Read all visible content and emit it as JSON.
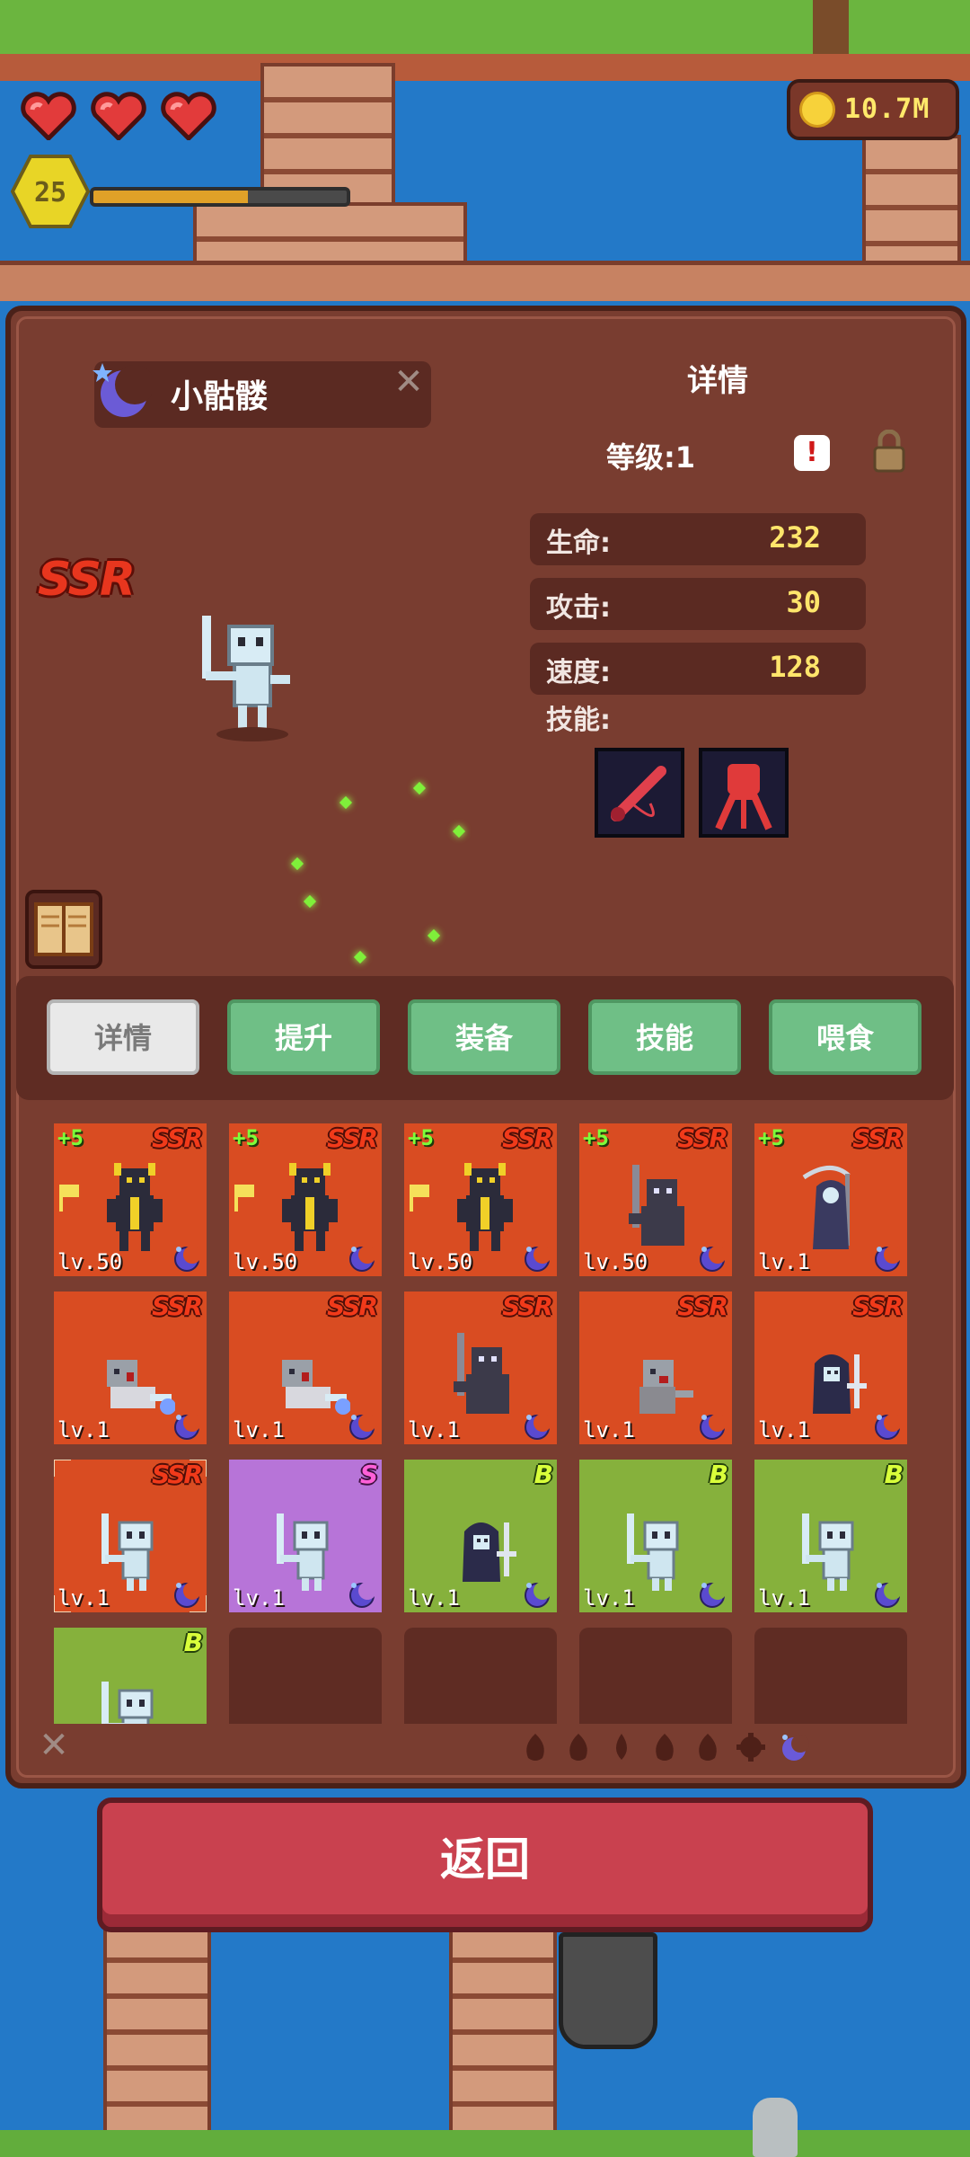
{
  "hud": {
    "hearts": 3,
    "player_level": "25",
    "xp_progress": 0.61,
    "coins": "10.7M"
  },
  "unit": {
    "name": "小骷髅",
    "rarity": "SSR",
    "detail_title": "详情",
    "level_text": "等级:1",
    "alert_glyph": "!",
    "stats": [
      {
        "label": "生命:",
        "value": "232"
      },
      {
        "label": "攻击:",
        "value": "30"
      },
      {
        "label": "速度:",
        "value": "128"
      }
    ],
    "skills_label": "技能:",
    "skills": [
      "sword-skill-icon",
      "fist-skill-icon"
    ]
  },
  "tabs": [
    {
      "label": "详情",
      "active": true
    },
    {
      "label": "提升",
      "active": false
    },
    {
      "label": "装备",
      "active": false
    },
    {
      "label": "技能",
      "active": false
    },
    {
      "label": "喂食",
      "active": false
    }
  ],
  "cards": [
    {
      "rarity": "SSR",
      "plus": "+5",
      "level": "lv.50",
      "flag": true,
      "sprite": "golden-knight"
    },
    {
      "rarity": "SSR",
      "plus": "+5",
      "level": "lv.50",
      "flag": true,
      "sprite": "golden-knight"
    },
    {
      "rarity": "SSR",
      "plus": "+5",
      "level": "lv.50",
      "flag": true,
      "sprite": "golden-knight"
    },
    {
      "rarity": "SSR",
      "plus": "+5",
      "level": "lv.50",
      "flag": false,
      "sprite": "dark-swordsman"
    },
    {
      "rarity": "SSR",
      "plus": "+5",
      "level": "lv.1",
      "flag": false,
      "sprite": "reaper"
    },
    {
      "rarity": "SSR",
      "plus": "",
      "level": "lv.1",
      "flag": false,
      "sprite": "zombie-crawler"
    },
    {
      "rarity": "SSR",
      "plus": "",
      "level": "lv.1",
      "flag": false,
      "sprite": "zombie-crawler"
    },
    {
      "rarity": "SSR",
      "plus": "",
      "level": "lv.1",
      "flag": false,
      "sprite": "dark-swordsman"
    },
    {
      "rarity": "SSR",
      "plus": "",
      "level": "lv.1",
      "flag": false,
      "sprite": "ghoul"
    },
    {
      "rarity": "SSR",
      "plus": "",
      "level": "lv.1",
      "flag": false,
      "sprite": "hooded-skeleton"
    },
    {
      "rarity": "SSR",
      "plus": "",
      "level": "lv.1",
      "flag": false,
      "sprite": "skeleton",
      "selected": true
    },
    {
      "rarity": "S",
      "plus": "",
      "level": "lv.1",
      "flag": false,
      "sprite": "skeleton"
    },
    {
      "rarity": "B",
      "plus": "",
      "level": "lv.1",
      "flag": false,
      "sprite": "hooded-skeleton"
    },
    {
      "rarity": "B",
      "plus": "",
      "level": "lv.1",
      "flag": false,
      "sprite": "skeleton"
    },
    {
      "rarity": "B",
      "plus": "",
      "level": "lv.1",
      "flag": false,
      "sprite": "skeleton"
    },
    {
      "rarity": "B",
      "plus": "",
      "level": "",
      "flag": false,
      "sprite": "skeleton"
    },
    {
      "rarity": "",
      "empty": true
    },
    {
      "rarity": "",
      "empty": true
    },
    {
      "rarity": "",
      "empty": true
    },
    {
      "rarity": "",
      "empty": true
    }
  ],
  "filters": [
    "fire-icon",
    "earth-icon",
    "water-icon",
    "wind-icon",
    "flame-icon",
    "gear-icon",
    "moon-icon"
  ],
  "colors": {
    "ssr_card": "#d94c22",
    "s_card": "#b774d8",
    "b_card": "#86b13c",
    "panel": "#793d30",
    "tab": "#6fbf86",
    "back_button": "#c9414f"
  },
  "back_button": "返回"
}
